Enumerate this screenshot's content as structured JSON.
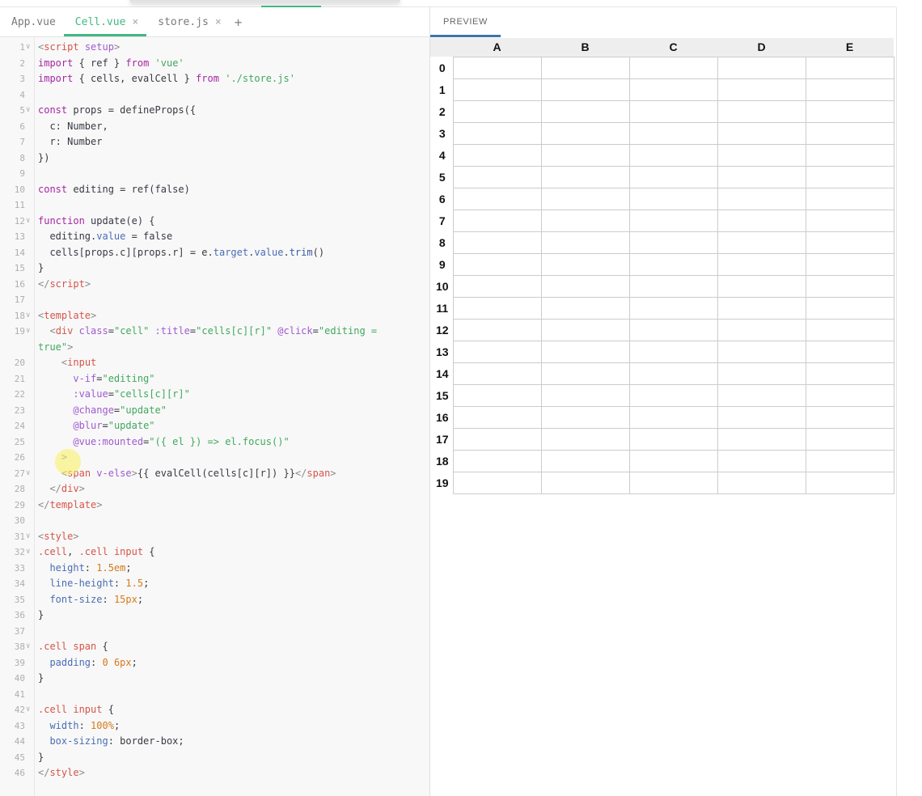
{
  "tabs": [
    {
      "label": "App.vue",
      "active": false,
      "closable": false
    },
    {
      "label": "Cell.vue",
      "active": true,
      "closable": true
    },
    {
      "label": "store.js",
      "active": false,
      "closable": true
    }
  ],
  "tab_add_label": "+",
  "tab_close_label": "×",
  "preview": {
    "tab_label": "PREVIEW",
    "columns": [
      "A",
      "B",
      "C",
      "D",
      "E"
    ],
    "rows": [
      "0",
      "1",
      "2",
      "3",
      "4",
      "5",
      "6",
      "7",
      "8",
      "9",
      "10",
      "11",
      "12",
      "13",
      "14",
      "15",
      "16",
      "17",
      "18",
      "19"
    ]
  },
  "code_lines": [
    {
      "n": "1",
      "fold": true,
      "t": [
        [
          "k-punc",
          "<"
        ],
        [
          "k-tag",
          "script"
        ],
        [
          "k-attr",
          " setup"
        ],
        [
          "k-punc",
          ">"
        ]
      ]
    },
    {
      "n": "2",
      "t": [
        [
          "k-kw",
          "import"
        ],
        [
          "k-plain",
          " { ref } "
        ],
        [
          "k-kw",
          "from"
        ],
        [
          "k-plain",
          " "
        ],
        [
          "k-str",
          "'vue'"
        ]
      ]
    },
    {
      "n": "3",
      "t": [
        [
          "k-kw",
          "import"
        ],
        [
          "k-plain",
          " { cells, evalCell } "
        ],
        [
          "k-kw",
          "from"
        ],
        [
          "k-plain",
          " "
        ],
        [
          "k-str",
          "'./store.js'"
        ]
      ]
    },
    {
      "n": "4",
      "t": []
    },
    {
      "n": "5",
      "fold": true,
      "t": [
        [
          "k-kw",
          "const"
        ],
        [
          "k-plain",
          " props = defineProps({"
        ]
      ]
    },
    {
      "n": "6",
      "t": [
        [
          "k-plain",
          "  c: Number,"
        ]
      ]
    },
    {
      "n": "7",
      "t": [
        [
          "k-plain",
          "  r: Number"
        ]
      ]
    },
    {
      "n": "8",
      "t": [
        [
          "k-plain",
          "})"
        ]
      ]
    },
    {
      "n": "9",
      "t": []
    },
    {
      "n": "10",
      "t": [
        [
          "k-kw",
          "const"
        ],
        [
          "k-plain",
          " editing = ref("
        ],
        [
          "k-plain",
          "false"
        ],
        [
          "k-plain",
          ")"
        ]
      ]
    },
    {
      "n": "11",
      "t": []
    },
    {
      "n": "12",
      "fold": true,
      "t": [
        [
          "k-kw",
          "function"
        ],
        [
          "k-plain",
          " update(e) {"
        ]
      ]
    },
    {
      "n": "13",
      "t": [
        [
          "k-plain",
          "  editing."
        ],
        [
          "k-prop",
          "value"
        ],
        [
          "k-plain",
          " = false"
        ]
      ]
    },
    {
      "n": "14",
      "t": [
        [
          "k-plain",
          "  cells[props.c][props.r] = e."
        ],
        [
          "k-prop",
          "target"
        ],
        [
          "k-plain",
          "."
        ],
        [
          "k-prop",
          "value"
        ],
        [
          "k-plain",
          "."
        ],
        [
          "k-fn",
          "trim"
        ],
        [
          "k-plain",
          "()"
        ]
      ]
    },
    {
      "n": "15",
      "t": [
        [
          "k-plain",
          "}"
        ]
      ]
    },
    {
      "n": "16",
      "t": [
        [
          "k-punc",
          "</"
        ],
        [
          "k-tag",
          "script"
        ],
        [
          "k-punc",
          ">"
        ]
      ]
    },
    {
      "n": "17",
      "t": []
    },
    {
      "n": "18",
      "fold": true,
      "t": [
        [
          "k-punc",
          "<"
        ],
        [
          "k-tag",
          "template"
        ],
        [
          "k-punc",
          ">"
        ]
      ]
    },
    {
      "n": "19",
      "fold": true,
      "t": [
        [
          "k-plain",
          "  "
        ],
        [
          "k-punc",
          "<"
        ],
        [
          "k-tag",
          "div"
        ],
        [
          "k-attr",
          " class"
        ],
        [
          "k-plain",
          "="
        ],
        [
          "k-str",
          "\"cell\""
        ],
        [
          "k-attr",
          " :title"
        ],
        [
          "k-plain",
          "="
        ],
        [
          "k-str",
          "\"cells[c][r]\""
        ],
        [
          "k-attr",
          " @click"
        ],
        [
          "k-plain",
          "="
        ],
        [
          "k-str",
          "\"editing ="
        ]
      ]
    },
    {
      "n": "",
      "t": [
        [
          "k-str",
          "true\""
        ],
        [
          "k-punc",
          ">"
        ]
      ]
    },
    {
      "n": "20",
      "t": [
        [
          "k-plain",
          "    "
        ],
        [
          "k-punc",
          "<"
        ],
        [
          "k-tag",
          "input"
        ]
      ]
    },
    {
      "n": "21",
      "t": [
        [
          "k-attr",
          "      v-if"
        ],
        [
          "k-plain",
          "="
        ],
        [
          "k-str",
          "\"editing\""
        ]
      ]
    },
    {
      "n": "22",
      "t": [
        [
          "k-attr",
          "      :value"
        ],
        [
          "k-plain",
          "="
        ],
        [
          "k-str",
          "\"cells[c][r]\""
        ]
      ]
    },
    {
      "n": "23",
      "t": [
        [
          "k-attr",
          "      @change"
        ],
        [
          "k-plain",
          "="
        ],
        [
          "k-str",
          "\"update\""
        ]
      ]
    },
    {
      "n": "24",
      "t": [
        [
          "k-attr",
          "      @blur"
        ],
        [
          "k-plain",
          "="
        ],
        [
          "k-str",
          "\"update\""
        ]
      ]
    },
    {
      "n": "25",
      "t": [
        [
          "k-attr",
          "      @vue:mounted"
        ],
        [
          "k-plain",
          "="
        ],
        [
          "k-str",
          "\"({ el }) => el.focus()\""
        ]
      ]
    },
    {
      "n": "26",
      "t": [
        [
          "k-punc",
          "    >"
        ]
      ]
    },
    {
      "n": "27",
      "fold": true,
      "t": [
        [
          "k-plain",
          "    "
        ],
        [
          "k-punc",
          "<"
        ],
        [
          "k-tag",
          "span"
        ],
        [
          "k-attr",
          " v-else"
        ],
        [
          "k-punc",
          ">"
        ],
        [
          "k-plain",
          "{{ evalCell(cells[c][r]) }}"
        ],
        [
          "k-punc",
          "</"
        ],
        [
          "k-tag",
          "span"
        ],
        [
          "k-punc",
          ">"
        ]
      ]
    },
    {
      "n": "28",
      "t": [
        [
          "k-plain",
          "  "
        ],
        [
          "k-punc",
          "</"
        ],
        [
          "k-tag",
          "div"
        ],
        [
          "k-punc",
          ">"
        ]
      ]
    },
    {
      "n": "29",
      "t": [
        [
          "k-punc",
          "</"
        ],
        [
          "k-tag",
          "template"
        ],
        [
          "k-punc",
          ">"
        ]
      ]
    },
    {
      "n": "30",
      "t": []
    },
    {
      "n": "31",
      "fold": true,
      "t": [
        [
          "k-punc",
          "<"
        ],
        [
          "k-tag",
          "style"
        ],
        [
          "k-punc",
          ">"
        ]
      ]
    },
    {
      "n": "32",
      "fold": true,
      "t": [
        [
          "k-sel",
          ".cell"
        ],
        [
          "k-plain",
          ", "
        ],
        [
          "k-sel",
          ".cell"
        ],
        [
          "k-plain",
          " "
        ],
        [
          "k-tag",
          "input"
        ],
        [
          "k-plain",
          " {"
        ]
      ]
    },
    {
      "n": "33",
      "t": [
        [
          "k-prop",
          "  height"
        ],
        [
          "k-plain",
          ": "
        ],
        [
          "k-num",
          "1.5em"
        ],
        [
          "k-plain",
          ";"
        ]
      ]
    },
    {
      "n": "34",
      "t": [
        [
          "k-prop",
          "  line-height"
        ],
        [
          "k-plain",
          ": "
        ],
        [
          "k-num",
          "1.5"
        ],
        [
          "k-plain",
          ";"
        ]
      ]
    },
    {
      "n": "35",
      "t": [
        [
          "k-prop",
          "  font-size"
        ],
        [
          "k-plain",
          ": "
        ],
        [
          "k-num",
          "15px"
        ],
        [
          "k-plain",
          ";"
        ]
      ]
    },
    {
      "n": "36",
      "t": [
        [
          "k-plain",
          "}"
        ]
      ]
    },
    {
      "n": "37",
      "t": []
    },
    {
      "n": "38",
      "fold": true,
      "t": [
        [
          "k-sel",
          ".cell"
        ],
        [
          "k-plain",
          " "
        ],
        [
          "k-tag",
          "span"
        ],
        [
          "k-plain",
          " {"
        ]
      ]
    },
    {
      "n": "39",
      "t": [
        [
          "k-prop",
          "  padding"
        ],
        [
          "k-plain",
          ": "
        ],
        [
          "k-num",
          "0"
        ],
        [
          "k-plain",
          " "
        ],
        [
          "k-num",
          "6px"
        ],
        [
          "k-plain",
          ";"
        ]
      ]
    },
    {
      "n": "40",
      "t": [
        [
          "k-plain",
          "}"
        ]
      ]
    },
    {
      "n": "41",
      "t": []
    },
    {
      "n": "42",
      "fold": true,
      "t": [
        [
          "k-sel",
          ".cell"
        ],
        [
          "k-plain",
          " "
        ],
        [
          "k-tag",
          "input"
        ],
        [
          "k-plain",
          " {"
        ]
      ]
    },
    {
      "n": "43",
      "t": [
        [
          "k-prop",
          "  width"
        ],
        [
          "k-plain",
          ": "
        ],
        [
          "k-num",
          "100%"
        ],
        [
          "k-plain",
          ";"
        ]
      ]
    },
    {
      "n": "44",
      "t": [
        [
          "k-prop",
          "  box-sizing"
        ],
        [
          "k-plain",
          ": border-box;"
        ]
      ]
    },
    {
      "n": "45",
      "t": [
        [
          "k-plain",
          "}"
        ]
      ]
    },
    {
      "n": "46",
      "t": [
        [
          "k-punc",
          "</"
        ],
        [
          "k-tag",
          "style"
        ],
        [
          "k-punc",
          ">"
        ]
      ]
    }
  ]
}
